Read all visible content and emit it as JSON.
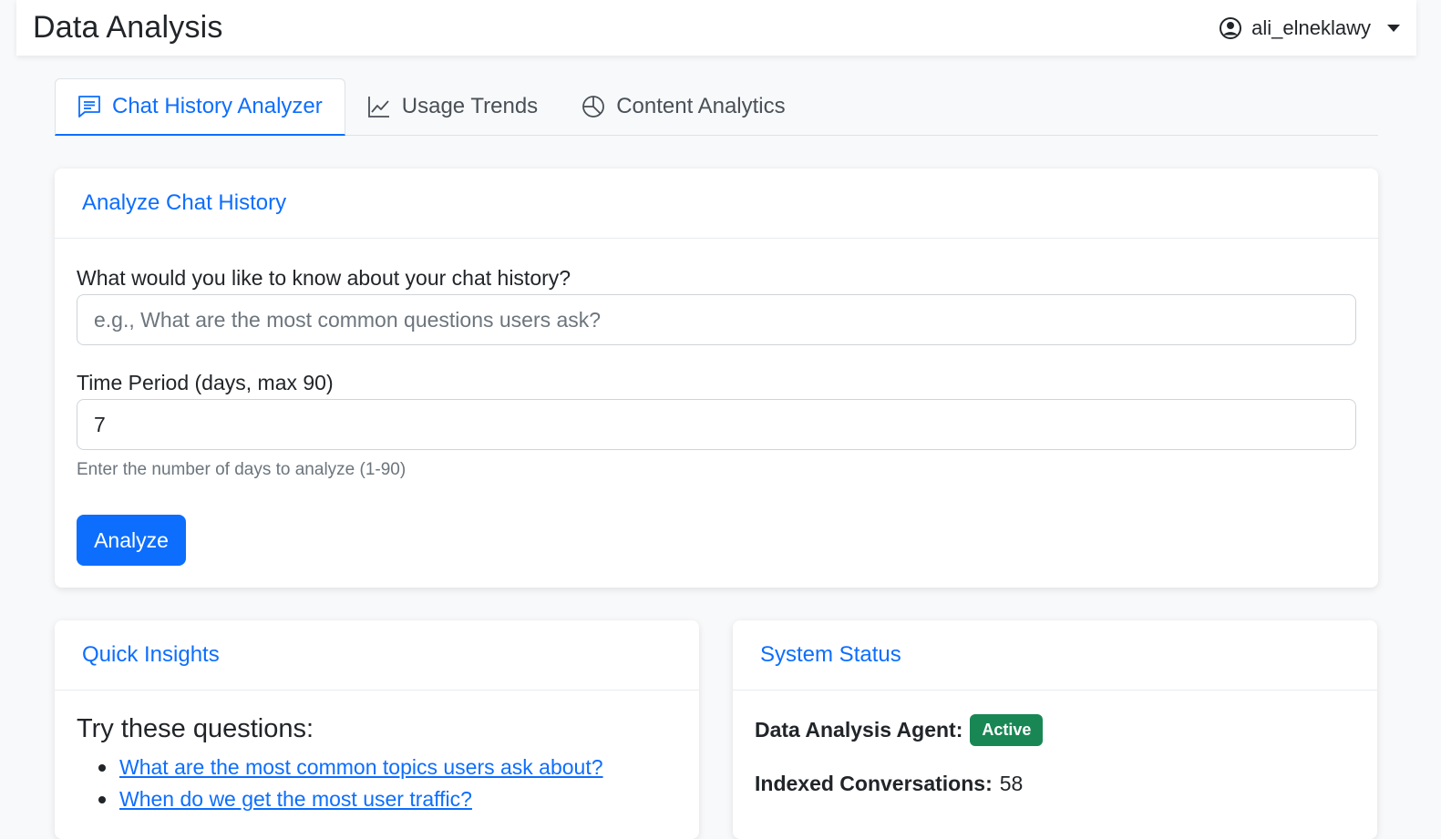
{
  "header": {
    "title": "Data Analysis",
    "user": "ali_elneklawy"
  },
  "tabs": [
    {
      "label": "Chat History Analyzer",
      "icon": "chat-text-icon",
      "active": true
    },
    {
      "label": "Usage Trends",
      "icon": "line-chart-icon",
      "active": false
    },
    {
      "label": "Content Analytics",
      "icon": "pie-chart-icon",
      "active": false
    }
  ],
  "analyze": {
    "title": "Analyze Chat History",
    "question_label": "What would you like to know about your chat history?",
    "question_placeholder": "e.g., What are the most common questions users ask?",
    "question_value": "",
    "period_label": "Time Period (days, max 90)",
    "period_value": "7",
    "period_help": "Enter the number of days to analyze (1-90)",
    "button": "Analyze"
  },
  "insights": {
    "title": "Quick Insights",
    "subtitle": "Try these questions:",
    "questions": [
      "What are the most common topics users ask about?",
      "When do we get the most user traffic?"
    ]
  },
  "status": {
    "title": "System Status",
    "agent_label": "Data Analysis Agent:",
    "agent_status": "Active",
    "conversations_label": "Indexed Conversations:",
    "conversations_value": "58"
  },
  "colors": {
    "accent": "#0d6efd",
    "success": "#198754",
    "background": "#f8f9fa"
  }
}
